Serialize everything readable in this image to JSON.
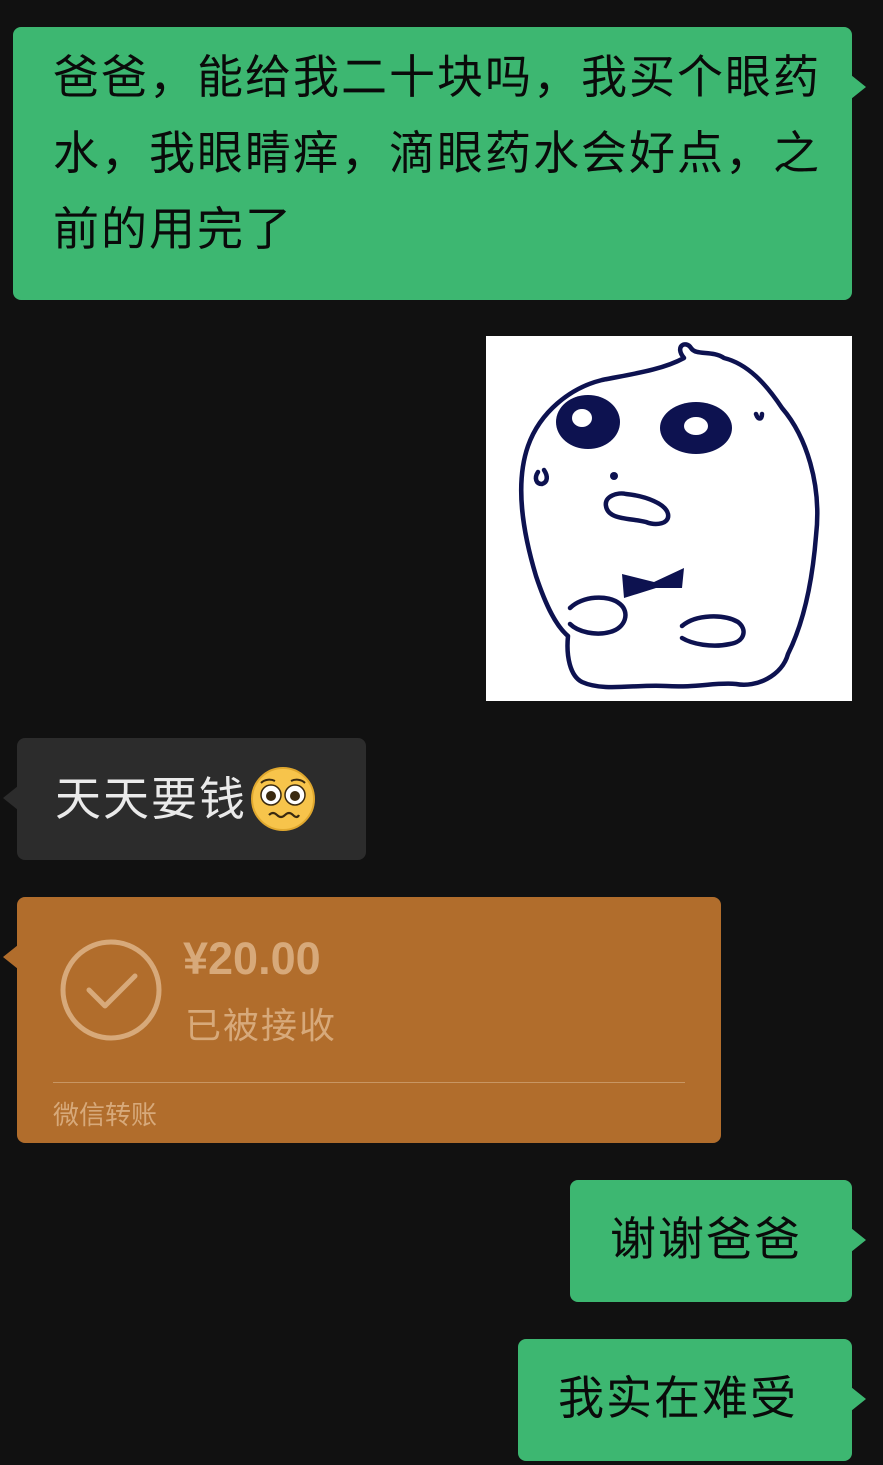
{
  "messages": {
    "m1": {
      "text": "爸爸，能给我二十块吗，我买个眼药水，我眼睛痒，滴眼药水会好点，之前的用完了"
    },
    "m2": {
      "text": "天天要钱"
    },
    "m3": {
      "text": "谢谢爸爸"
    },
    "m4": {
      "text": "我实在难受"
    }
  },
  "transfer": {
    "amount": "¥20.00",
    "status": "已被接收",
    "service": "微信转账"
  },
  "icons": {
    "sticker": "worried-blob-sticker",
    "emoji": "pleading-face-emoji",
    "check": "check-circle-icon"
  },
  "colors": {
    "background": "#111111",
    "sent_bubble": "#3db771",
    "received_bubble": "#2c2c2c",
    "transfer_card": "#b16d2c"
  }
}
